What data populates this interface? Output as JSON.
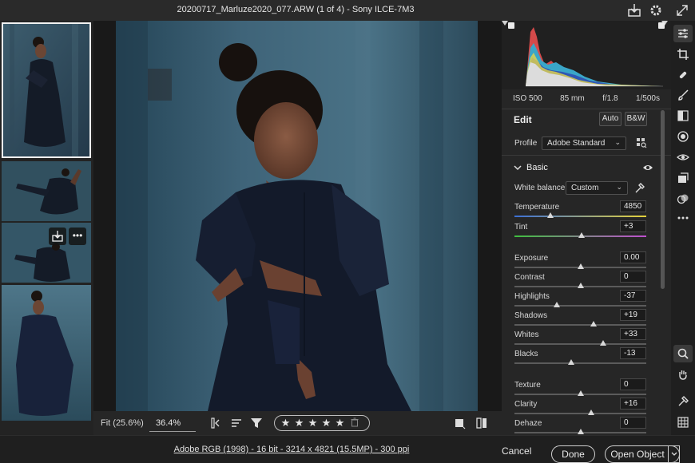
{
  "titlebar": {
    "title": "20200717_Marluze2020_077.ARW (1 of 4)  -  Sony ILCE-7M3",
    "icons": [
      "save-icon",
      "gear-icon",
      "expand-icon"
    ]
  },
  "filmstrip": {
    "overlay_icons": [
      "import-icon",
      "more-icon"
    ],
    "overlay_more": "•••"
  },
  "canvas_bar": {
    "fit_label": "Fit (25.6%)",
    "zoom_value": "36.4%",
    "stars": [
      "★",
      "★",
      "★",
      "★",
      "★"
    ],
    "trash_glyph": "🗑"
  },
  "camera_info": {
    "iso": "ISO 500",
    "focal": "85 mm",
    "aperture": "f/1.8",
    "shutter": "1/500s"
  },
  "edit": {
    "title": "Edit",
    "auto_label": "Auto",
    "bw_label": "B&W",
    "profile_label": "Profile",
    "profile_value": "Adobe Standard",
    "basic_label": "Basic",
    "white_balance_label": "White balance",
    "white_balance_value": "Custom",
    "sliders": [
      {
        "label": "Temperature",
        "value": "4850",
        "pos": 0.27
      },
      {
        "label": "Tint",
        "value": "+3",
        "pos": 0.51
      },
      {
        "label": "Exposure",
        "value": "0.00",
        "pos": 0.5
      },
      {
        "label": "Contrast",
        "value": "0",
        "pos": 0.5
      },
      {
        "label": "Highlights",
        "value": "-37",
        "pos": 0.32
      },
      {
        "label": "Shadows",
        "value": "+19",
        "pos": 0.6
      },
      {
        "label": "Whites",
        "value": "+33",
        "pos": 0.67
      },
      {
        "label": "Blacks",
        "value": "-13",
        "pos": 0.43
      },
      {
        "label": "Texture",
        "value": "0",
        "pos": 0.5
      },
      {
        "label": "Clarity",
        "value": "+16",
        "pos": 0.58
      },
      {
        "label": "Dehaze",
        "value": "0",
        "pos": 0.5
      }
    ]
  },
  "statusbar": {
    "info": "Adobe RGB (1998) - 16 bit - 3214 x 4821 (15.5MP) - 300 ppi",
    "cancel_label": "Cancel",
    "done_label": "Done",
    "open_label": "Open Object"
  },
  "colors": {
    "panel_bg": "#262626",
    "accent_track_temp_start": "#3b6fd6",
    "accent_track_temp_end": "#e5d23a",
    "accent_track_tint_start": "#3fbf3f",
    "accent_track_tint_end": "#c04fd0"
  }
}
